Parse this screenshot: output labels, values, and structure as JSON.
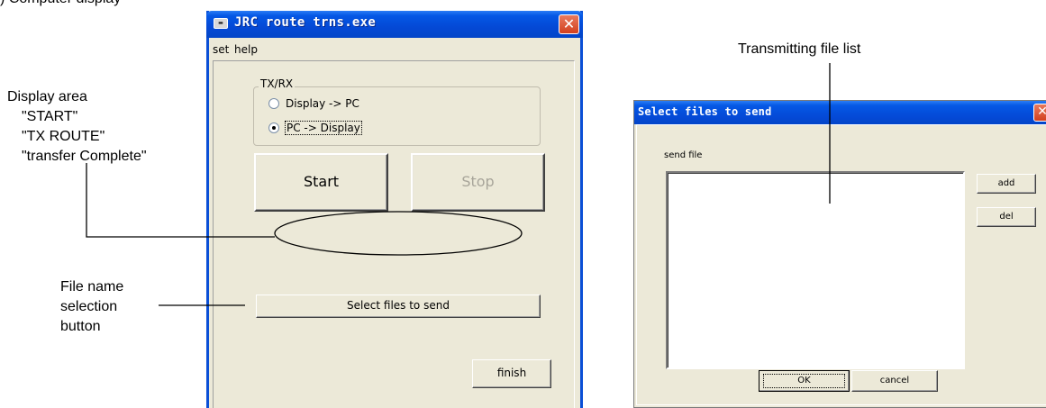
{
  "cutoff_caption": ") Computer display",
  "annotations": {
    "display_area": {
      "heading": "Display area",
      "items": [
        "\"START\"",
        "\"TX ROUTE\"",
        "\"transfer Complete\""
      ]
    },
    "file_name_button": [
      "File name",
      "selection",
      "button"
    ],
    "tx_file_list": "Transmitting file list"
  },
  "main_window": {
    "title": "JRC route trns.exe",
    "icon_name": "app-icon",
    "close_glyph": "✕",
    "menu": [
      "set",
      "help"
    ],
    "group": {
      "title": "TX/RX",
      "options": [
        {
          "label": "Display -> PC",
          "selected": false
        },
        {
          "label": "PC -> Display",
          "selected": true
        }
      ]
    },
    "start_label": "Start",
    "stop_label": "Stop",
    "select_files_label": "Select files to send",
    "finish_label": "finish"
  },
  "send_dialog": {
    "title": "Select files to send",
    "close_glyph": "✕",
    "list_label": "send file",
    "files": [],
    "add_label": "add",
    "del_label": "del",
    "ok_label": "OK",
    "cancel_label": "cancel"
  },
  "colors": {
    "title_blue": "#0449d6",
    "window_face": "#ece9d8",
    "close_red": "#d2401e",
    "disabled_text": "#a8a59a"
  }
}
